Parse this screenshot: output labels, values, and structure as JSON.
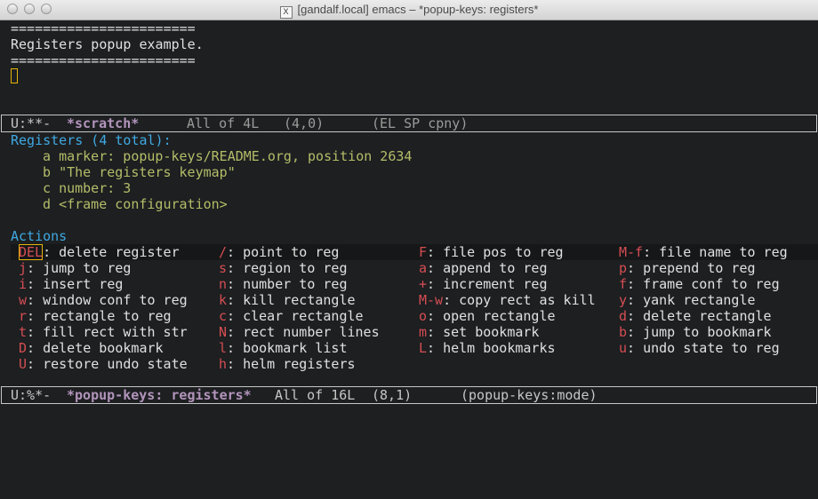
{
  "window": {
    "title": "[gandalf.local] emacs – *popup-keys: registers*",
    "x_icon": "X"
  },
  "scratch": {
    "rule": "=======================",
    "heading": "Registers popup example."
  },
  "modeline_top": {
    "status": "U:**-",
    "buffer": "*scratch*",
    "position": "All of 4L",
    "cursor": "(4,0)",
    "modes": "(EL SP cpny)"
  },
  "registers": {
    "header": "Registers (4 total):",
    "items": [
      {
        "key": "a",
        "value": "marker: popup-keys/README.org, position 2634"
      },
      {
        "key": "b",
        "value": "\"The registers keymap\""
      },
      {
        "key": "c",
        "value": "number: 3"
      },
      {
        "key": "d",
        "value": "<frame configuration>"
      }
    ]
  },
  "actions": {
    "header": "Actions",
    "rows": [
      [
        {
          "k": "DEL",
          "d": ": delete register"
        },
        {
          "k": "/",
          "d": ": point to reg"
        },
        {
          "k": "F",
          "d": ": file pos to reg"
        },
        {
          "k": "M-f",
          "d": ": file name to reg"
        }
      ],
      [
        {
          "k": "j",
          "d": ": jump to reg"
        },
        {
          "k": "s",
          "d": ": region to reg"
        },
        {
          "k": "a",
          "d": ": append to reg"
        },
        {
          "k": "p",
          "d": ": prepend to reg"
        }
      ],
      [
        {
          "k": "i",
          "d": ": insert reg"
        },
        {
          "k": "n",
          "d": ": number to reg"
        },
        {
          "k": "+",
          "d": ": increment reg"
        },
        {
          "k": "f",
          "d": ": frame conf to reg"
        }
      ],
      [
        {
          "k": "w",
          "d": ": window conf to reg"
        },
        {
          "k": "k",
          "d": ": kill rectangle"
        },
        {
          "k": "M-w",
          "d": ": copy rect as kill"
        },
        {
          "k": "y",
          "d": ": yank rectangle"
        }
      ],
      [
        {
          "k": "r",
          "d": ": rectangle to reg"
        },
        {
          "k": "c",
          "d": ": clear rectangle"
        },
        {
          "k": "o",
          "d": ": open rectangle"
        },
        {
          "k": "d",
          "d": ": delete rectangle"
        }
      ],
      [
        {
          "k": "t",
          "d": ": fill rect with str"
        },
        {
          "k": "N",
          "d": ": rect number lines"
        },
        {
          "k": "m",
          "d": ": set bookmark"
        },
        {
          "k": "b",
          "d": ": jump to bookmark"
        }
      ],
      [
        {
          "k": "D",
          "d": ": delete bookmark"
        },
        {
          "k": "l",
          "d": ": bookmark list"
        },
        {
          "k": "L",
          "d": ": helm bookmarks"
        },
        {
          "k": "u",
          "d": ": undo state to reg"
        }
      ],
      [
        {
          "k": "U",
          "d": ": restore undo state"
        },
        {
          "k": "h",
          "d": ": helm registers"
        }
      ]
    ]
  },
  "modeline_bottom": {
    "status": "U:%*-",
    "buffer": "*popup-keys: registers*",
    "position": "All of 16L",
    "cursor": "(8,1)",
    "modes": "(popup-keys:mode)"
  },
  "colors": {
    "background": "#1d1f21",
    "header_blue": "#3fa9e2",
    "register_green": "#b5bd68",
    "key_red": "#d54e53",
    "buffer_purple": "#b294bb",
    "cursor_yellow": "#e6b40a"
  }
}
